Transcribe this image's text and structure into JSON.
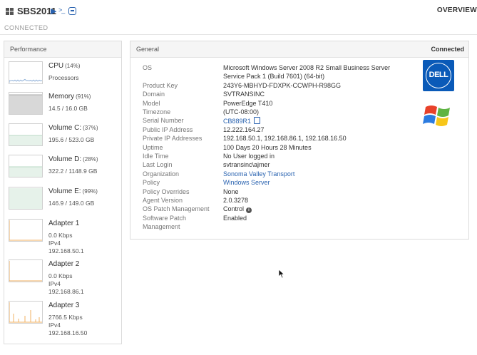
{
  "header": {
    "host_name": "SBS2011",
    "shell_icon_text": ">_",
    "overview_label": "OVERVIEW",
    "connection_status": "CONNECTED"
  },
  "performance": {
    "title": "Performance",
    "items": [
      {
        "label": "CPU",
        "pct": "(14%)",
        "lines": [
          "Processors"
        ],
        "chart": "line"
      },
      {
        "label": "Memory",
        "pct": "(91%)",
        "lines": [
          "14.5 / 16.0 GB"
        ],
        "chart": "fill-high"
      },
      {
        "label": "Volume C:",
        "pct": "(37%)",
        "lines": [
          "195.6 / 523.0 GB"
        ],
        "chart": "fill"
      },
      {
        "label": "Volume D:",
        "pct": "(28%)",
        "lines": [
          "322.2 / 1148.9 GB"
        ],
        "chart": "fill"
      },
      {
        "label": "Volume E:",
        "pct": "(99%)",
        "lines": [
          "146.9 / 149.0 GB"
        ],
        "chart": "fill-full"
      },
      {
        "label": "Adapter 1",
        "pct": "",
        "lines": [
          "0.0 Kbps",
          "IPv4",
          "192.168.50.1"
        ],
        "chart": "net"
      },
      {
        "label": "Adapter 2",
        "pct": "",
        "lines": [
          "0.0 Kbps",
          "IPv4",
          "192.168.86.1"
        ],
        "chart": "net"
      },
      {
        "label": "Adapter 3",
        "pct": "",
        "lines": [
          "2766.5 Kbps",
          "IPv4",
          "192.168.16.50"
        ],
        "chart": "net-spikes"
      }
    ]
  },
  "general": {
    "title": "General",
    "status": "Connected",
    "fields": [
      {
        "label": "OS",
        "value": "Microsoft Windows Server 2008 R2 Small Business Server"
      },
      {
        "label": "",
        "value": "Service Pack 1 (Build 7601) (64-bit)"
      },
      {
        "label": "Product Key",
        "value": "243Y6-MBHYD-FDXPK-CCWPH-R98GG"
      },
      {
        "label": "Domain",
        "value": "SVTRANSINC"
      },
      {
        "label": "Model",
        "value": "PowerEdge T410"
      },
      {
        "label": "Timezone",
        "value": "(UTC-08:00)"
      },
      {
        "label": "Serial Number",
        "value": "CB889R1",
        "link": true,
        "icon": "copy"
      },
      {
        "label": "Public IP Address",
        "value": "12.222.164.27"
      },
      {
        "label": "Private IP Addresses",
        "value": "192.168.50.1, 192.168.86.1, 192.168.16.50"
      },
      {
        "label": "Uptime",
        "value": "100 Days 20 Hours 28 Minutes"
      },
      {
        "label": "Idle Time",
        "value": "No User logged in"
      },
      {
        "label": "Last Login",
        "value": "svtransinc\\ajmer"
      },
      {
        "label": "Organization",
        "value": "Sonoma Valley Transport",
        "link": true
      },
      {
        "label": "Policy",
        "value": "Windows Server",
        "link": true
      },
      {
        "label": "Policy Overrides",
        "value": "None"
      },
      {
        "label": "Agent Version",
        "value": "2.0.3278"
      },
      {
        "label": "OS Patch Management",
        "value": "Control",
        "icon": "info"
      },
      {
        "label": "Software Patch",
        "value": "Enabled"
      },
      {
        "label": "Management",
        "value": ""
      }
    ],
    "vendor_logo_text": "DELL"
  },
  "colors": {
    "accent": "#2a63b0",
    "volume_fill": "#e6f2ea",
    "memory_fill": "#d8d8d8",
    "network_line": "#f0b060"
  }
}
